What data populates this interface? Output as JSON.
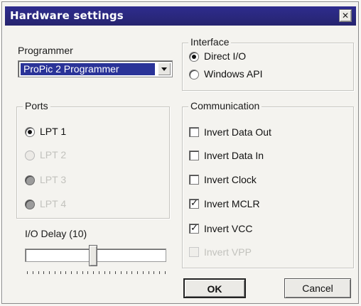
{
  "window": {
    "title": "Hardware settings",
    "close_glyph": "✕"
  },
  "programmer": {
    "label": "Programmer",
    "selected": "ProPic 2 Programmer"
  },
  "ports": {
    "caption": "Ports",
    "options": [
      {
        "label": "LPT 1",
        "checked": true,
        "enabled": true
      },
      {
        "label": "LPT 2",
        "checked": false,
        "enabled": false
      },
      {
        "label": "LPT 3",
        "checked": false,
        "enabled": false
      },
      {
        "label": "LPT 4",
        "checked": false,
        "enabled": false
      }
    ]
  },
  "io_delay": {
    "label": "I/O Delay (10)",
    "value": 10,
    "fraction": 0.48
  },
  "interface": {
    "caption": "Interface",
    "options": [
      {
        "label": "Direct I/O",
        "checked": true
      },
      {
        "label": "Windows API",
        "checked": false
      }
    ]
  },
  "communication": {
    "caption": "Communication",
    "items": [
      {
        "label": "Invert Data Out",
        "checked": false,
        "enabled": true
      },
      {
        "label": "Invert Data In",
        "checked": false,
        "enabled": true
      },
      {
        "label": "Invert Clock",
        "checked": false,
        "enabled": true
      },
      {
        "label": "Invert MCLR",
        "checked": true,
        "enabled": true
      },
      {
        "label": "Invert VCC",
        "checked": true,
        "enabled": true
      },
      {
        "label": "Invert VPP",
        "checked": false,
        "enabled": false
      }
    ]
  },
  "buttons": {
    "ok": "OK",
    "cancel": "Cancel"
  },
  "colors": {
    "titlebar": "#26246f",
    "selection": "#2a3398"
  },
  "icons": {
    "close": "close-icon",
    "dropdown": "chevron-down-icon",
    "check": "check-icon"
  }
}
